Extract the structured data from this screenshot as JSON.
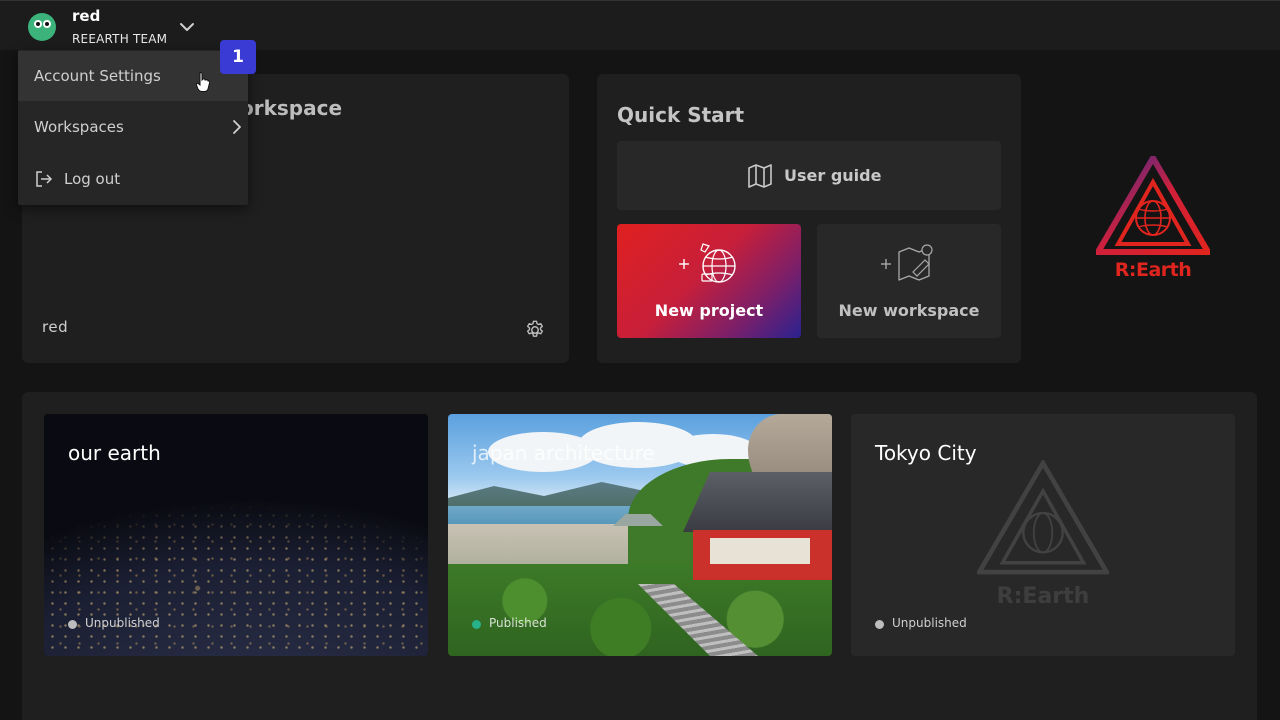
{
  "header": {
    "user_name": "red",
    "team_name": "REEARTH TEAM"
  },
  "dropdown": {
    "badge": "1",
    "items": [
      {
        "label": "Account Settings",
        "icon": "none"
      },
      {
        "label": "Workspaces",
        "icon": "chevron-right-icon"
      },
      {
        "label": "Log out",
        "icon": "logout-icon"
      }
    ]
  },
  "workspace_card": {
    "title": "orkspace",
    "name": "red"
  },
  "quick_start": {
    "title": "Quick Start",
    "user_guide": "User guide",
    "new_project": "New project",
    "new_workspace": "New workspace"
  },
  "logo": {
    "text": "R:Earth",
    "color": "#e0241e"
  },
  "projects": [
    {
      "title": "our earth",
      "status": "Unpublished",
      "status_color": "#bdbdbd"
    },
    {
      "title": "japan architecture",
      "status": "Published",
      "status_color": "#27b08a"
    },
    {
      "title": "Tokyo City",
      "status": "Unpublished",
      "status_color": "#bdbdbd",
      "placeholder_logo_text": "R:Earth"
    }
  ],
  "colors": {
    "badge": "#3a3ad4",
    "new_project_gradient": [
      "#e02020",
      "#2a2290"
    ]
  }
}
